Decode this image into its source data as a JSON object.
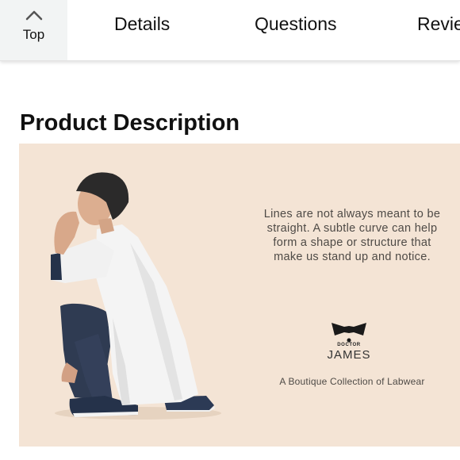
{
  "nav": {
    "top_label": "Top",
    "tabs": [
      {
        "label": "Details"
      },
      {
        "label": "Questions"
      },
      {
        "label": "Revie"
      }
    ]
  },
  "section": {
    "title": "Product Description"
  },
  "banner": {
    "copy": "Lines are not always meant to be straight. A subtle curve can help form a shape or structure that make us stand up and notice.",
    "brand_small": "DOCTOR",
    "brand_name": "JAMES",
    "tagline": "A Boutique Collection of Labwear",
    "background_color": "#f4e4d5"
  }
}
